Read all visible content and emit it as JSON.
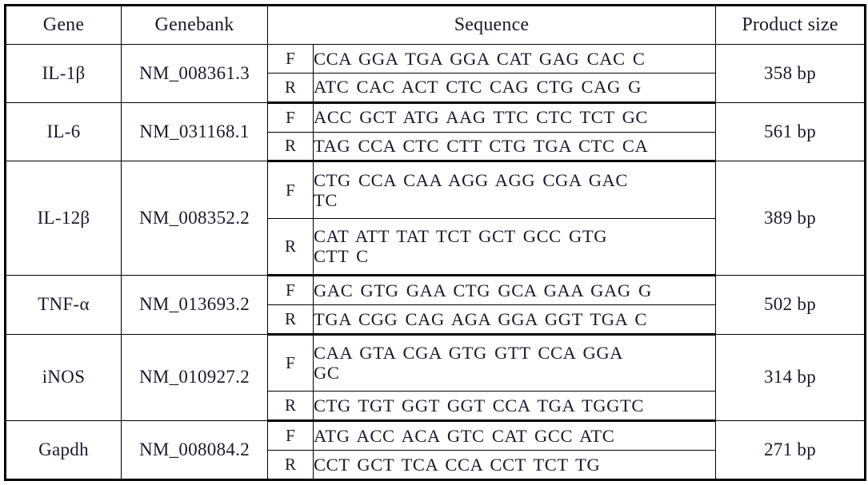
{
  "table": {
    "headers": {
      "gene": "Gene",
      "genebank": "Genebank",
      "sequence": "Sequence",
      "product_size": "Product size"
    },
    "direction_labels": {
      "forward": "F",
      "reverse": "R"
    },
    "rows": [
      {
        "gene": "IL-1β",
        "genebank": "NM_008361.3",
        "product_size": "358 bp",
        "forward": [
          "CCA GGA TGA GGA CAT GAG CAC C"
        ],
        "reverse": [
          "ATC CAC ACT CTC CAG CTG CAG G"
        ]
      },
      {
        "gene": "IL-6",
        "genebank": "NM_031168.1",
        "product_size": "561 bp",
        "forward": [
          "ACC GCT ATG AAG TTC CTC TCT GC"
        ],
        "reverse": [
          "TAG CCA CTC CTT CTG TGA CTC CA"
        ]
      },
      {
        "gene": "IL-12β",
        "genebank": "NM_008352.2",
        "product_size": "389 bp",
        "forward": [
          "CTG CCA CAA AGG AGG CGA GAC",
          "TC"
        ],
        "reverse": [
          "CAT ATT TAT TCT GCT GCC GTG",
          "CTT C"
        ]
      },
      {
        "gene": "TNF-α",
        "genebank": "NM_013693.2",
        "product_size": "502 bp",
        "forward": [
          "GAC GTG GAA CTG GCA GAA GAG G"
        ],
        "reverse": [
          "TGA CGG CAG AGA GGA GGT TGA C"
        ]
      },
      {
        "gene": "iNOS",
        "genebank": "NM_010927.2",
        "product_size": "314 bp",
        "forward": [
          "CAA GTA CGA GTG GTT CCA GGA",
          "GC"
        ],
        "reverse": [
          "CTG TGT GGT GGT CCA TGA TGGTC"
        ]
      },
      {
        "gene": "Gapdh",
        "genebank": "NM_008084.2",
        "product_size": "271 bp",
        "forward": [
          "ATG ACC ACA GTC CAT GCC ATC"
        ],
        "reverse": [
          "CCT GCT TCA CCA CCT TCT TG"
        ]
      }
    ]
  },
  "colors": {
    "border": "#000000",
    "text": "#1a1a2e",
    "background": "#ffffff"
  }
}
